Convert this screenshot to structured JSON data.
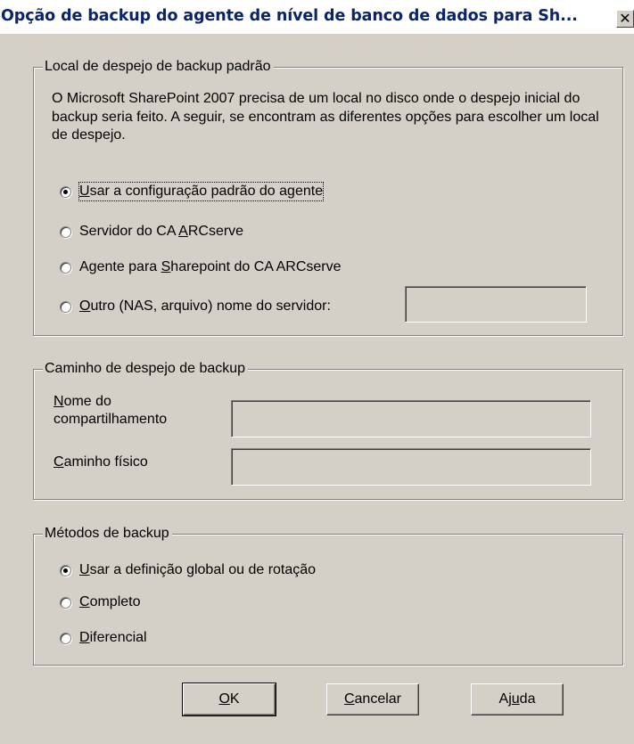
{
  "window": {
    "title": "Opção de backup do agente de nível de banco de dados para Sh...",
    "close_glyph": "✕"
  },
  "dump_location": {
    "legend": "Local de despejo de backup padrão",
    "description": "O Microsoft SharePoint 2007 precisa de um local no disco onde o despejo inicial do backup seria feito. A seguir, se encontram as diferentes opções para escolher um local de despejo.",
    "options": [
      {
        "pre": "",
        "key": "U",
        "post": "sar a configuração padrão do agente",
        "checked": true
      },
      {
        "pre": "Servidor do CA ",
        "key": "A",
        "post": "RCserve",
        "checked": false
      },
      {
        "pre": "Agente para ",
        "key": "S",
        "post": "harepoint do CA ARCserve",
        "checked": false
      },
      {
        "pre": "",
        "key": "O",
        "post": "utro (NAS, arquivo)  nome do servidor:",
        "checked": false
      }
    ],
    "server_name_value": ""
  },
  "dump_path": {
    "legend": "Caminho de despejo de backup",
    "share_label_key": "N",
    "share_label_line1_rest": "ome do",
    "share_label_line2": "compartilhamento",
    "share_value": "",
    "physical_label_key": "C",
    "physical_label_rest": "aminho físico",
    "physical_value": ""
  },
  "methods": {
    "legend": "Métodos de backup",
    "options": [
      {
        "pre": "",
        "key": "U",
        "post": "sar a definição global ou de rotação",
        "checked": true
      },
      {
        "pre": "",
        "key": "C",
        "post": "ompleto",
        "checked": false
      },
      {
        "pre": "",
        "key": "D",
        "post": "iferencial",
        "checked": false
      }
    ]
  },
  "buttons": {
    "ok": {
      "pre": "",
      "key": "O",
      "post": "K"
    },
    "cancel": {
      "pre": "",
      "key": "C",
      "post": "ancelar"
    },
    "help": {
      "pre": "Aj",
      "key": "u",
      "post": "da"
    }
  },
  "colors": {
    "face": "#d4d0c8",
    "title_text": "#0a246a"
  }
}
